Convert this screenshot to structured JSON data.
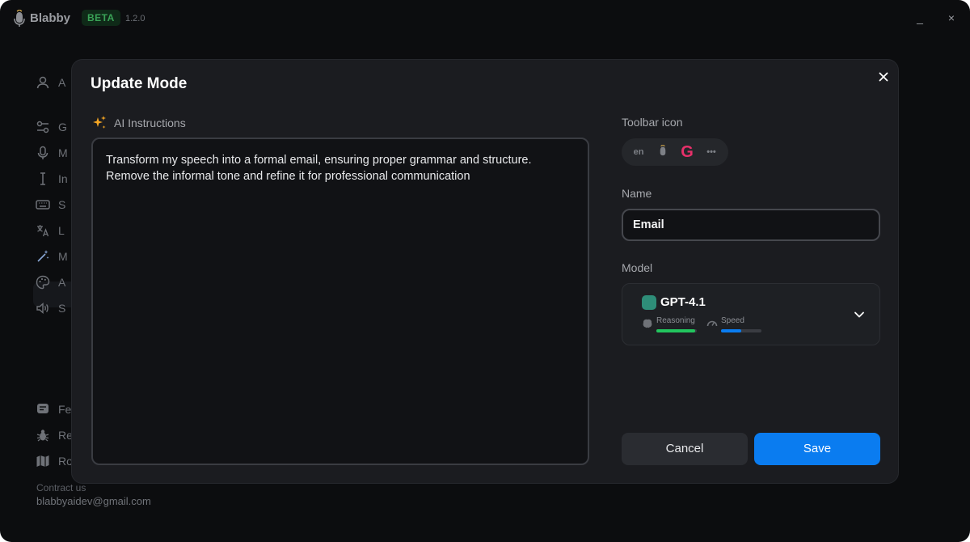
{
  "app": {
    "name": "Blabby",
    "badge": "BETA",
    "version": "1.2.0",
    "minimize_glyph": "_",
    "close_glyph": "×"
  },
  "sidebar": {
    "items": [
      {
        "label": "A",
        "icon": "user-icon"
      },
      {
        "label": "G",
        "icon": "sliders-icon"
      },
      {
        "label": "M",
        "icon": "microphone-icon"
      },
      {
        "label": "In",
        "icon": "text-cursor-icon"
      },
      {
        "label": "S",
        "icon": "keyboard-icon"
      },
      {
        "label": "L",
        "icon": "translate-icon"
      },
      {
        "label": "M",
        "icon": "magic-wand-icon"
      },
      {
        "label": "A",
        "icon": "palette-icon"
      },
      {
        "label": "S",
        "icon": "speaker-icon"
      },
      {
        "label": "Fe",
        "icon": "feedback-icon"
      },
      {
        "label": "Re",
        "icon": "bug-icon"
      },
      {
        "label": "Ro",
        "icon": "map-icon"
      }
    ],
    "contact_label": "Contract us",
    "contact_email": "blabbyaidev@gmail.com"
  },
  "modal": {
    "title": "Update Mode",
    "ai_label": "AI Instructions",
    "instructions": "Transform my speech into a formal email, ensuring proper grammar and structure.\nRemove the informal tone and refine it for professional communication",
    "toolbar_label": "Toolbar icon",
    "toolbar_icons": {
      "lang": "en",
      "more": "•••",
      "selected": "G"
    },
    "name_label": "Name",
    "name_value": "Email",
    "model_label": "Model",
    "model": {
      "name": "GPT-4.1",
      "reasoning_label": "Reasoning",
      "reasoning_level": 0.95,
      "speed_label": "Speed",
      "speed_level": 0.5
    },
    "cancel_label": "Cancel",
    "save_label": "Save"
  },
  "colors": {
    "accent": "#0a7cf0",
    "beta_green": "#3aa357",
    "reasoning_bar": "#22c55e",
    "speed_bar": "#0a7cf0",
    "sparkle": "#f5a623",
    "selected_icon": "#e8306a"
  }
}
